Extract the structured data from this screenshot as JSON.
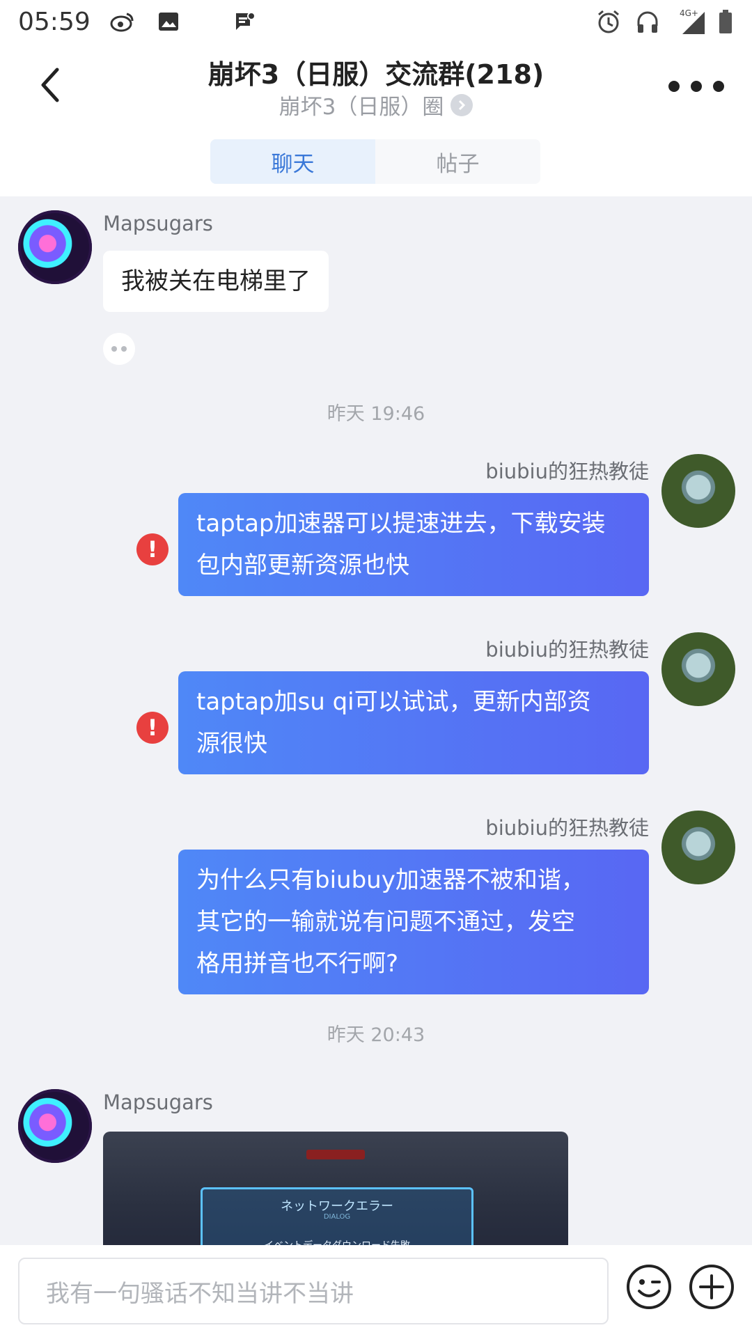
{
  "status_bar": {
    "time": "05:59",
    "network": "4G+"
  },
  "header": {
    "title": "崩坏3（日服）交流群(218)",
    "subtitle": "崩坏3（日服）圈",
    "tabs": [
      {
        "label": "聊天",
        "active": true
      },
      {
        "label": "帖子",
        "active": false
      }
    ]
  },
  "messages": [
    {
      "user": "Mapsugars",
      "text": "我被关在电梯里了",
      "side": "in"
    },
    {
      "timestamp": "昨天 19:46"
    },
    {
      "user": "biubiu的狂热教徒",
      "text_lines": [
        "taptap加速器可以提速进去，下载安装",
        "包内部更新资源也快"
      ],
      "side": "out",
      "failed": true
    },
    {
      "user": "biubiu的狂热教徒",
      "text_lines": [
        "taptap加su qi可以试试，更新内部资",
        "源很快"
      ],
      "side": "out",
      "failed": true
    },
    {
      "user": "biubiu的狂热教徒",
      "text_lines": [
        "为什么只有biubuy加速器不被和谐，",
        "其它的一输就说有问题不通过，发空",
        "格用拼音也不行啊?"
      ],
      "side": "out",
      "failed": false
    },
    {
      "timestamp": "昨天 20:43"
    },
    {
      "user": "Mapsugars",
      "image": true,
      "image_text": {
        "title": "ネットワークエラー",
        "sub": "DIALOG",
        "body": "イベントデータダウンロード失敗"
      },
      "side": "in"
    }
  ],
  "input": {
    "placeholder": "我有一句骚话不知当讲不当讲"
  },
  "colors": {
    "accent": "#3a78d8",
    "bubble_out_start": "#4f88f7",
    "bubble_out_end": "#5867f3",
    "error": "#e8403f"
  },
  "icons": {
    "back": "chevron-left-icon",
    "more": "more-dots-icon",
    "emoji": "emoji-icon",
    "plus": "plus-circle-icon",
    "error": "exclamation-icon"
  }
}
